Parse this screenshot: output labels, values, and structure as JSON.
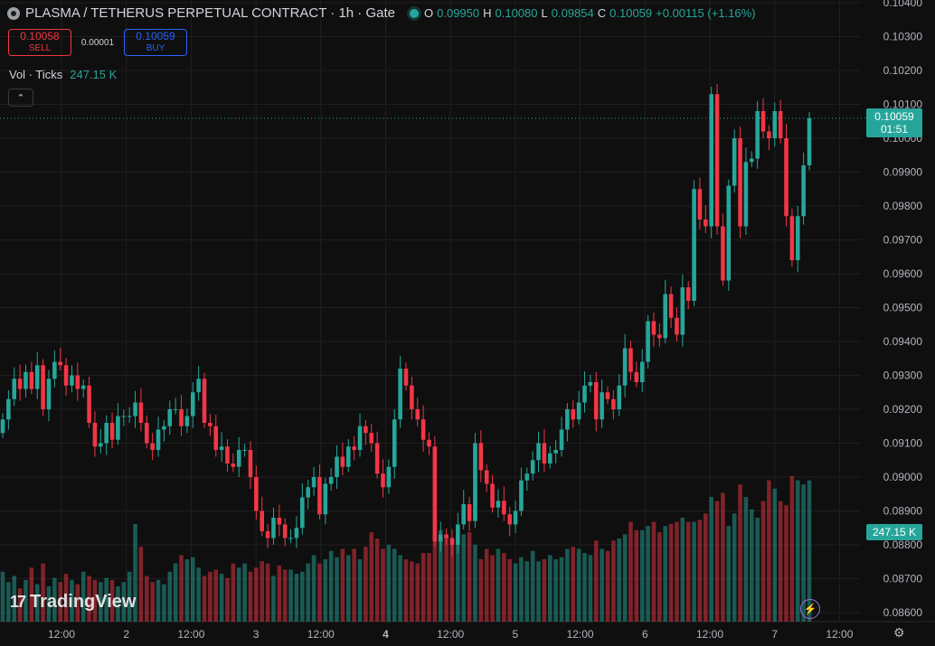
{
  "header": {
    "title": "PLASMA / TETHERUS PERPETUAL CONTRACT · 1h · Gate",
    "ohlc": {
      "o_label": "O",
      "o": "0.09950",
      "h_label": "H",
      "h": "0.10080",
      "l_label": "L",
      "l": "0.09854",
      "c_label": "C",
      "c": "0.10059",
      "change": "+0.00115 (+1.16%)"
    }
  },
  "trade": {
    "sell_price": "0.10058",
    "sell_label": "SELL",
    "spread": "0.00001",
    "buy_price": "0.10059",
    "buy_label": "BUY"
  },
  "volume_legend": {
    "label": "Vol · Ticks",
    "value": "247.15 K"
  },
  "price_badge": {
    "price": "0.10059",
    "countdown": "01:51"
  },
  "volume_badge": "247.15 K",
  "branding": "TradingView",
  "colors": {
    "up": "#26a69a",
    "down": "#f23645",
    "background": "#0f0f0f",
    "grid": "#1f1f1f"
  },
  "icons": [
    "symbol-icon",
    "collapse-chevron-icon",
    "tradingview-logo-icon",
    "lightning-icon",
    "settings-gear-icon"
  ],
  "chart_data": {
    "type": "candlestick",
    "title": "PLASMA / TETHERUS PERPETUAL CONTRACT · 1h · Gate",
    "y_ticks": [
      "0.10400",
      "0.10300",
      "0.10200",
      "0.10100",
      "0.10000",
      "0.09900",
      "0.09800",
      "0.09700",
      "0.09600",
      "0.09500",
      "0.09400",
      "0.09300",
      "0.09200",
      "0.09100",
      "0.09000",
      "0.08900",
      "0.08800",
      "0.08700",
      "0.08600"
    ],
    "x_ticks": [
      "12:00",
      "2",
      "12:00",
      "3",
      "12:00",
      "4",
      "12:00",
      "5",
      "12:00",
      "6",
      "12:00",
      "7",
      "12:00"
    ],
    "ylim": [
      0.0855,
      0.1045
    ],
    "last_price": 0.10059,
    "candles_close": [
      0.0917,
      0.0923,
      0.0929,
      0.0926,
      0.0931,
      0.0926,
      0.0933,
      0.092,
      0.0929,
      0.0934,
      0.0933,
      0.0927,
      0.093,
      0.0926,
      0.0927,
      0.0916,
      0.0909,
      0.091,
      0.0916,
      0.0911,
      0.0918,
      0.0918,
      0.0918,
      0.0922,
      0.0916,
      0.091,
      0.0908,
      0.0914,
      0.0915,
      0.092,
      0.092,
      0.0915,
      0.0918,
      0.0925,
      0.0929,
      0.0916,
      0.0915,
      0.0908,
      0.0909,
      0.0904,
      0.0903,
      0.0908,
      0.0908,
      0.09,
      0.089,
      0.0884,
      0.0882,
      0.0888,
      0.0886,
      0.0882,
      0.0882,
      0.0885,
      0.0894,
      0.0897,
      0.09,
      0.0889,
      0.0898,
      0.09,
      0.0906,
      0.0903,
      0.0909,
      0.0908,
      0.0915,
      0.0913,
      0.091,
      0.0901,
      0.0897,
      0.0903,
      0.0917,
      0.0932,
      0.0927,
      0.092,
      0.0917,
      0.0911,
      0.0909,
      0.0881,
      0.0883,
      0.0882,
      0.088,
      0.0886,
      0.0892,
      0.0887,
      0.091,
      0.0902,
      0.0898,
      0.0891,
      0.0893,
      0.0889,
      0.0886,
      0.089,
      0.0899,
      0.0901,
      0.0905,
      0.091,
      0.0904,
      0.0907,
      0.0908,
      0.0914,
      0.092,
      0.0917,
      0.0922,
      0.0927,
      0.0928,
      0.0917,
      0.0925,
      0.0923,
      0.092,
      0.0927,
      0.0938,
      0.0931,
      0.0928,
      0.0934,
      0.0946,
      0.0942,
      0.0941,
      0.0954,
      0.0947,
      0.0942,
      0.0956,
      0.0952,
      0.0985,
      0.0976,
      0.0974,
      0.1013,
      0.0974,
      0.0958,
      0.0986,
      0.1,
      0.0974,
      0.0993,
      0.0994,
      0.1008,
      0.1002,
      0.1,
      0.1008,
      0.1,
      0.0977,
      0.0964,
      0.0977,
      0.0992,
      0.10059
    ],
    "volume_ticks_k": [
      120,
      95,
      110,
      80,
      100,
      130,
      90,
      140,
      85,
      105,
      95,
      115,
      100,
      90,
      120,
      110,
      100,
      95,
      105,
      100,
      85,
      95,
      120,
      235,
      180,
      110,
      95,
      100,
      90,
      120,
      140,
      160,
      150,
      155,
      130,
      110,
      120,
      125,
      115,
      105,
      140,
      130,
      140,
      120,
      130,
      145,
      140,
      110,
      135,
      125,
      125,
      115,
      120,
      140,
      160,
      140,
      150,
      170,
      155,
      175,
      160,
      175,
      150,
      180,
      215,
      200,
      175,
      185,
      175,
      160,
      150,
      145,
      140,
      165,
      165,
      240,
      220,
      210,
      195,
      185,
      210,
      215,
      185,
      150,
      175,
      160,
      175,
      165,
      150,
      140,
      155,
      145,
      170,
      145,
      150,
      160,
      150,
      155,
      175,
      180,
      175,
      165,
      160,
      195,
      175,
      170,
      195,
      200,
      210,
      240,
      220,
      220,
      230,
      240,
      215,
      230,
      235,
      240,
      250,
      240,
      240,
      245,
      260,
      300,
      290,
      310,
      230,
      260,
      330,
      300,
      270,
      250,
      290,
      340,
      320,
      290,
      280,
      350,
      340,
      330,
      340,
      350,
      360,
      370
    ]
  }
}
